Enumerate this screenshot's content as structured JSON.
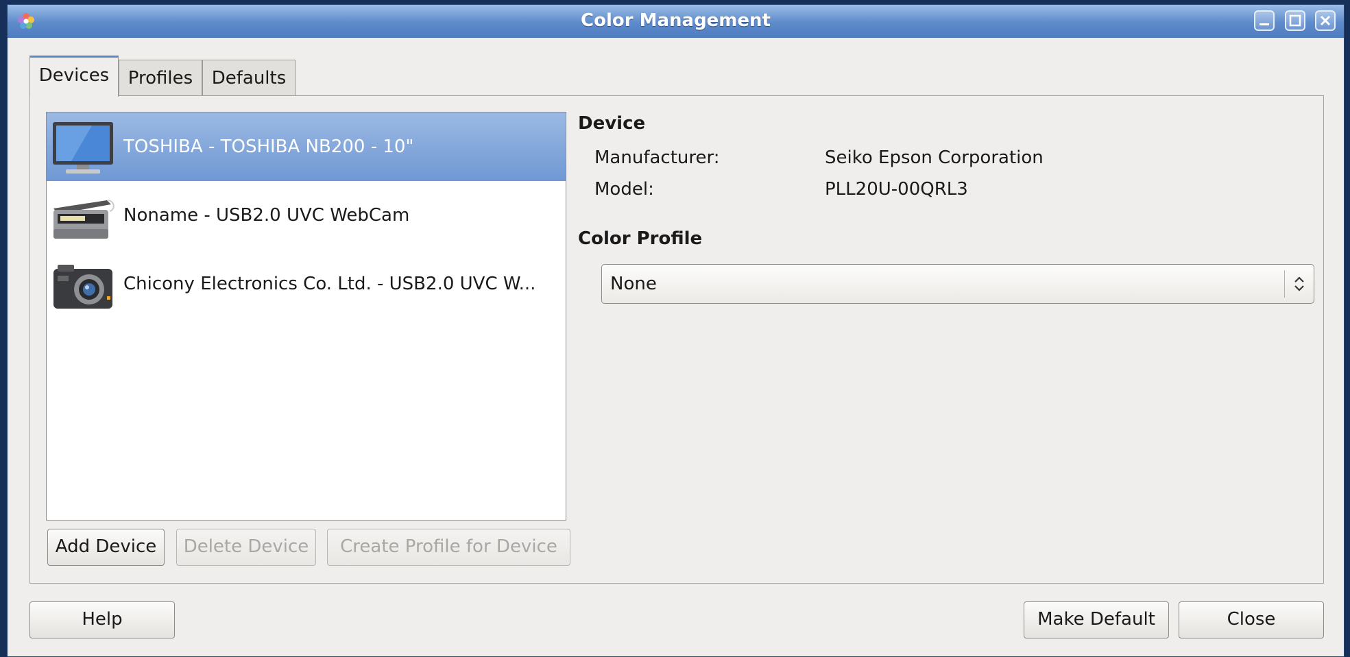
{
  "window": {
    "title": "Color Management"
  },
  "tabs": [
    {
      "label": "Devices",
      "active": true
    },
    {
      "label": "Profiles",
      "active": false
    },
    {
      "label": "Defaults",
      "active": false
    }
  ],
  "devices": [
    {
      "label": "TOSHIBA - TOSHIBA NB200 - 10\"",
      "icon": "monitor-icon",
      "selected": true
    },
    {
      "label": "Noname - USB2.0 UVC WebCam",
      "icon": "scanner-icon",
      "selected": false
    },
    {
      "label": "Chicony Electronics Co.  Ltd. - USB2.0 UVC W...",
      "icon": "camera-icon",
      "selected": false
    }
  ],
  "list_buttons": {
    "add": "Add Device",
    "delete": "Delete Device",
    "create_profile": "Create Profile for Device"
  },
  "device_info": {
    "heading": "Device",
    "manufacturer_label": "Manufacturer:",
    "manufacturer_value": "Seiko Epson Corporation",
    "model_label": "Model:",
    "model_value": "PLL20U-00QRL3"
  },
  "color_profile": {
    "heading": "Color Profile",
    "selected": "None"
  },
  "footer": {
    "help": "Help",
    "make_default": "Make Default",
    "close": "Close"
  },
  "colors": {
    "titlebar": "#5e8bcb",
    "selection": "#7fa3d9",
    "window_bg": "#efeeec",
    "desktop": "#16305a"
  }
}
